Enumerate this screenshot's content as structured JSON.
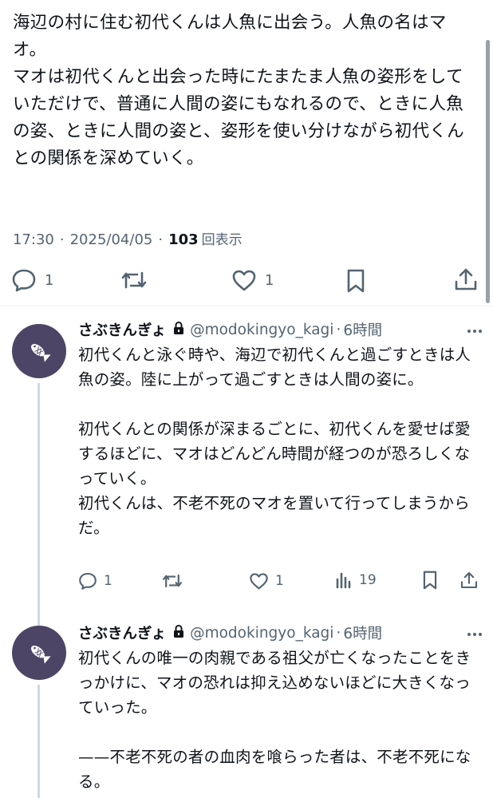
{
  "main_tweet": {
    "text": "海辺の村に住む初代くんは人魚に出会う。人魚の名はマオ。\nマオは初代くんと出会った時にたまたま人魚の姿形をしていただけで、普通に人間の姿にもなれるので、ときに人魚の姿、ときに人間の姿と、姿形を使い分けながら初代くんとの関係を深めていく。",
    "time": "17:30",
    "date": "2025/04/05",
    "views_count": "103",
    "views_label": "回表示",
    "reply_count": "1",
    "like_count": "1"
  },
  "replies": [
    {
      "display_name": "さぶきんぎょ",
      "handle": "@modokingyo_kagi",
      "time": "6時間",
      "text": "初代くんと泳ぐ時や、海辺で初代くんと過ごすときは人魚の姿。陸に上がって過ごすときは人間の姿に。\n\n初代くんとの関係が深まるごとに、初代くんを愛せば愛するほどに、マオはどんどん時間が経つのが恐ろしくなっていく。\n初代くんは、不老不死のマオを置いて行ってしまうからだ。",
      "reply_count": "1",
      "like_count": "1",
      "views_count": "19"
    },
    {
      "display_name": "さぶきんぎょ",
      "handle": "@modokingyo_kagi",
      "time": "6時間",
      "text": "初代くんの唯一の肉親である祖父が亡くなったことをきっかけに、マオの恐れは抑え込めないほどに大きくなっていった。\n\n——不老不死の者の血肉を喰らった者は、不老不死になる。"
    }
  ],
  "icons": {
    "reply": "speech-bubble-icon",
    "retweet": "repost-arrows-icon",
    "like": "heart-icon",
    "bookmark": "bookmark-icon",
    "share": "share-upload-icon",
    "views": "bar-chart-icon",
    "lock": "lock-icon",
    "avatar": "fish-icon"
  },
  "colors": {
    "text": "#0f1419",
    "muted": "#536471",
    "avatar_bg": "#4d4565",
    "thread_line": "#cfd9de"
  }
}
